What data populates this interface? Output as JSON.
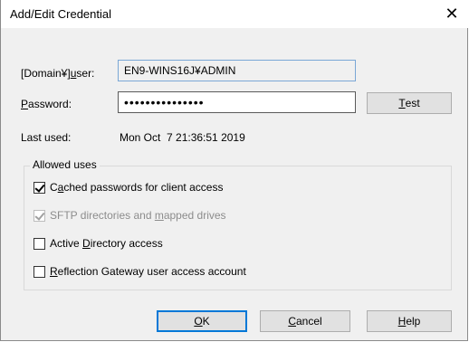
{
  "dialog": {
    "title": "Add/Edit Credential",
    "close_glyph": "✕"
  },
  "form": {
    "user_label_pre": "[Domain¥]",
    "user_label_u": "u",
    "user_label_post": "ser:",
    "user_value": "EN9-WINS16J¥ADMIN",
    "password_label_u": "P",
    "password_label_post": "assword:",
    "password_value": "•••••••••••••••",
    "last_used_label": "Last used:",
    "last_used_value": "Mon Oct  7 21:36:51 2019"
  },
  "buttons": {
    "test_u": "T",
    "test_rest": "est",
    "ok_u": "O",
    "ok_rest": "K",
    "cancel_u": "C",
    "cancel_rest": "ancel",
    "help_u": "H",
    "help_rest": "elp"
  },
  "allowed_uses": {
    "label": "Allowed uses",
    "items": [
      {
        "pre": "C",
        "u": "a",
        "post": "ched passwords for client access",
        "checked": true,
        "enabled": true
      },
      {
        "pre": "SFTP directories and ",
        "u": "m",
        "post": "apped drives",
        "checked": true,
        "enabled": false
      },
      {
        "pre": "Active ",
        "u": "D",
        "post": "irectory access",
        "checked": false,
        "enabled": true
      },
      {
        "pre": "",
        "u": "R",
        "post": "eflection Gateway user access account",
        "checked": false,
        "enabled": true
      }
    ]
  }
}
